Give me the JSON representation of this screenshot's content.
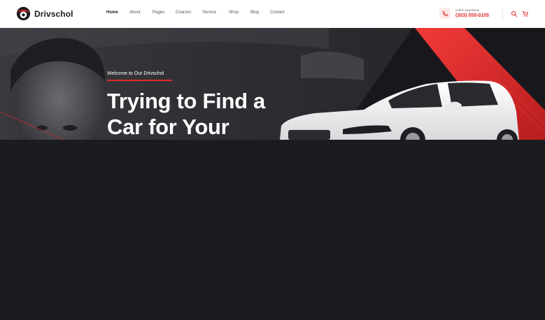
{
  "brand": {
    "name": "Drivschol"
  },
  "nav": {
    "items": [
      {
        "label": "Home",
        "active": true
      },
      {
        "label": "About",
        "active": false
      },
      {
        "label": "Pages",
        "active": false
      },
      {
        "label": "Courses",
        "active": false
      },
      {
        "label": "Service",
        "active": false
      },
      {
        "label": "Shop",
        "active": false
      },
      {
        "label": "Blog",
        "active": false
      },
      {
        "label": "Contact",
        "active": false
      }
    ]
  },
  "contact": {
    "label": "Call to Questions",
    "phone": "(303) 555-0105",
    "icon": "phone-icon"
  },
  "header_tools": {
    "search_icon": "search-icon",
    "cart_icon": "cart-icon"
  },
  "hero": {
    "kicker": "Welcome to Our Drivschol",
    "headline_line1": "Trying to Find a",
    "headline_line2": "Car for Your"
  },
  "colors": {
    "accent": "#e12b2b",
    "dark": "#1c1b1f",
    "header_bg": "#ffffff"
  }
}
